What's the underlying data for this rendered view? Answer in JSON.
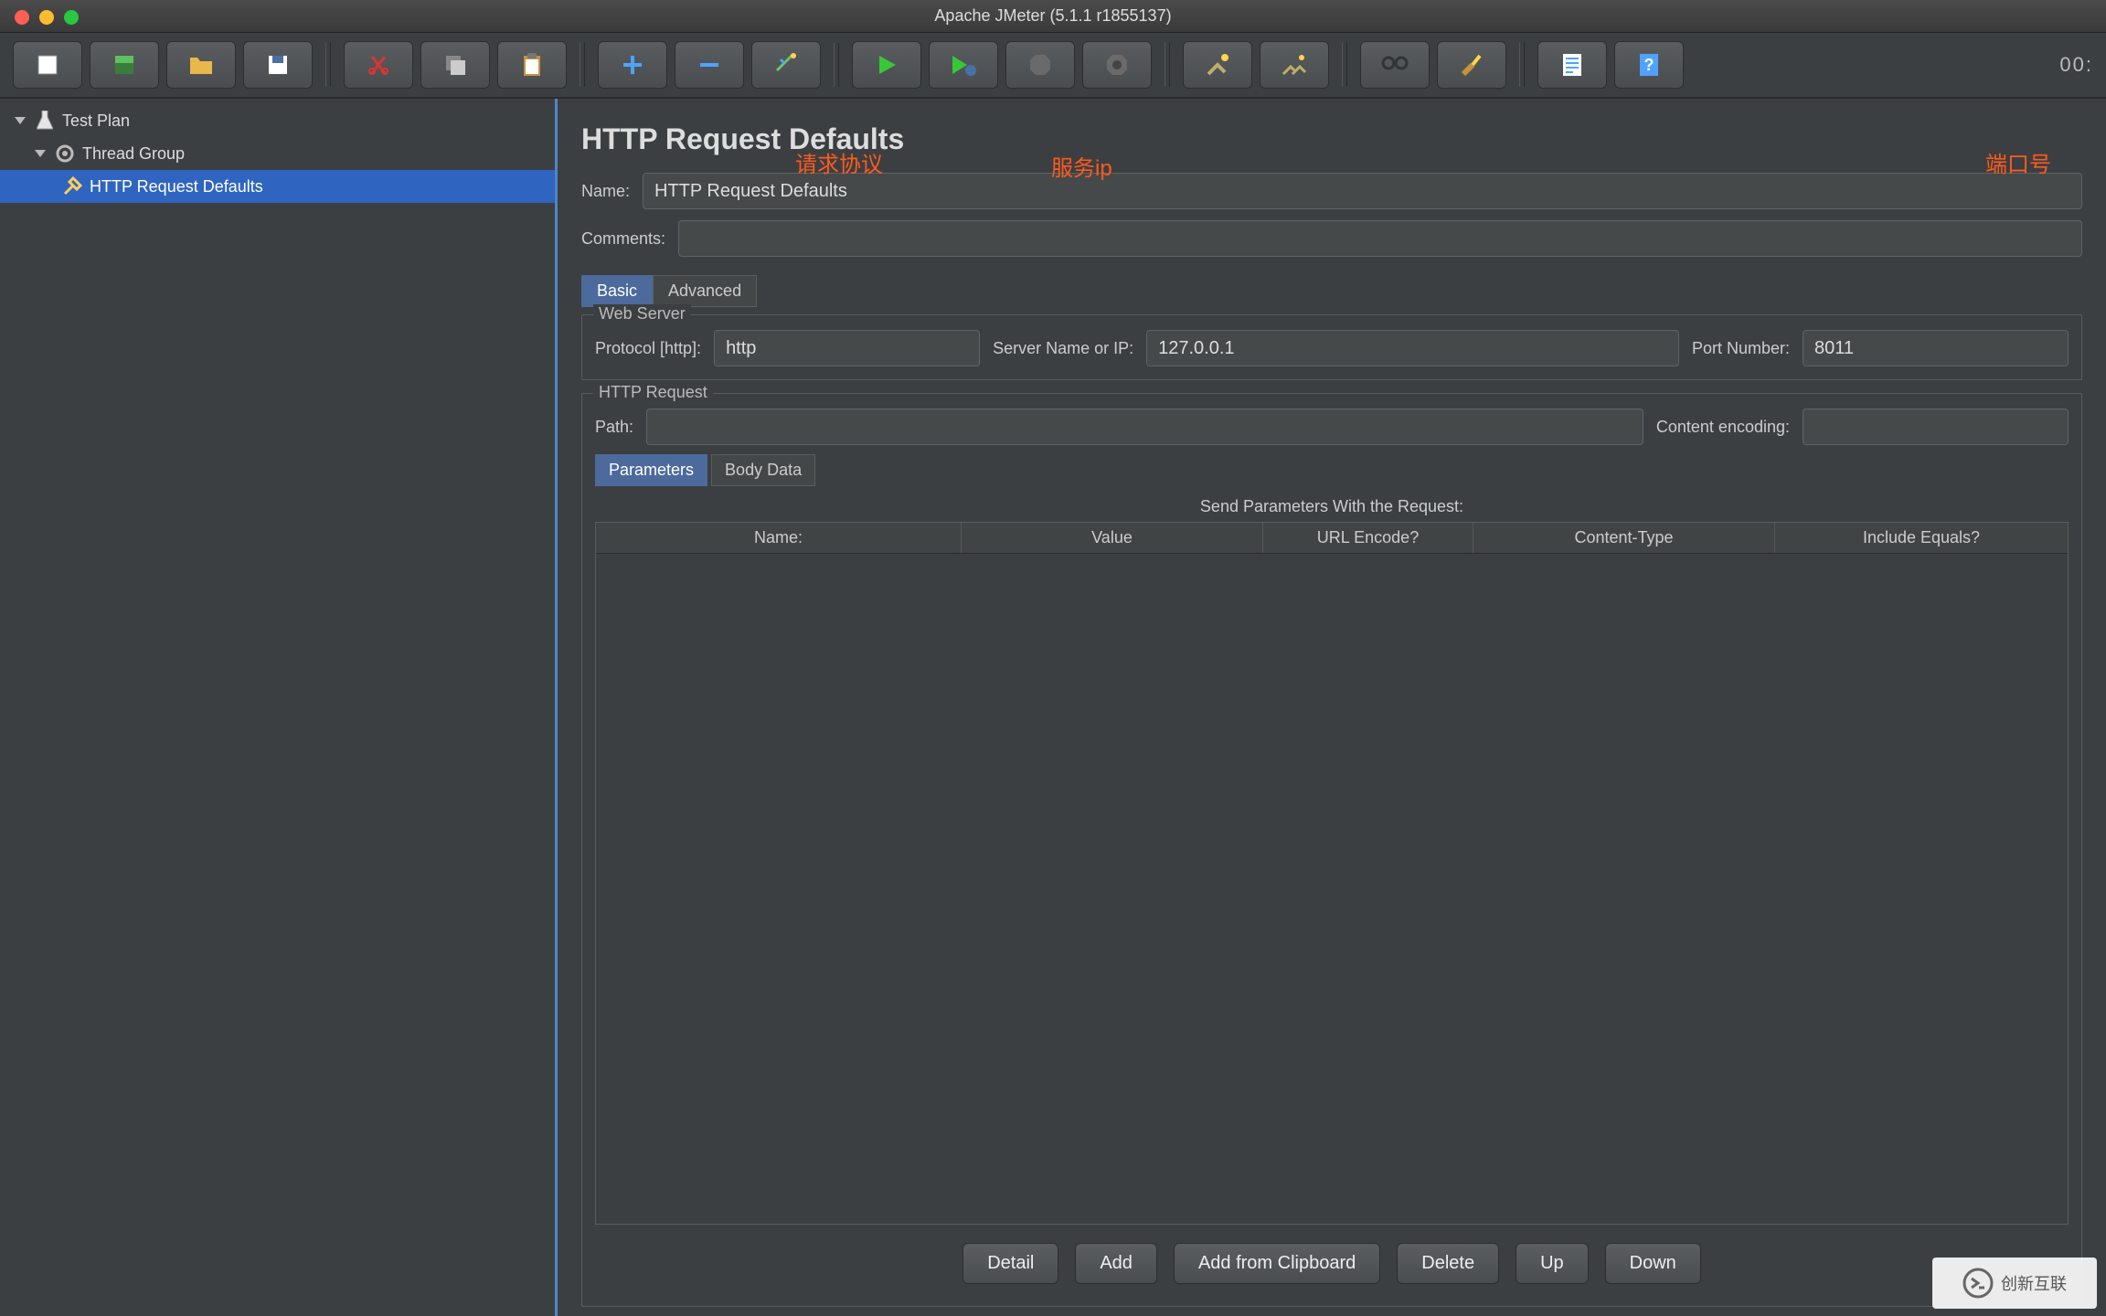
{
  "window": {
    "title": "Apache JMeter (5.1.1 r1855137)"
  },
  "toolbar": {
    "buttons": [
      "new",
      "templates",
      "open",
      "save",
      "cut",
      "copy",
      "paste",
      "add",
      "remove",
      "toggle",
      "start",
      "start-no-timers",
      "stop",
      "shutdown",
      "clear",
      "clear-all",
      "search",
      "reset-search",
      "function-helper",
      "help"
    ],
    "timer": "00:"
  },
  "tree": {
    "nodes": [
      {
        "label": "Test Plan",
        "icon": "flask"
      },
      {
        "label": "Thread Group",
        "icon": "gear"
      },
      {
        "label": "HTTP Request Defaults",
        "icon": "wrench",
        "selected": true
      }
    ]
  },
  "panel": {
    "heading": "HTTP Request Defaults",
    "name_label": "Name:",
    "name_value": "HTTP Request Defaults",
    "comments_label": "Comments:",
    "comments_value": "",
    "tabs": {
      "basic": "Basic",
      "advanced": "Advanced"
    },
    "web_server": {
      "legend": "Web Server",
      "protocol_label": "Protocol [http]:",
      "protocol_value": "http",
      "server_label": "Server Name or IP:",
      "server_value": "127.0.0.1",
      "port_label": "Port Number:",
      "port_value": "8011"
    },
    "http_request": {
      "legend": "HTTP Request",
      "path_label": "Path:",
      "path_value": "",
      "encoding_label": "Content encoding:",
      "encoding_value": ""
    },
    "param_tabs": {
      "parameters": "Parameters",
      "body": "Body Data"
    },
    "param_header": "Send Parameters With the Request:",
    "columns": [
      "Name:",
      "Value",
      "URL Encode?",
      "Content-Type",
      "Include Equals?"
    ],
    "buttons": {
      "detail": "Detail",
      "add": "Add",
      "clipboard": "Add from Clipboard",
      "delete": "Delete",
      "up": "Up",
      "down": "Down"
    }
  },
  "annotations": {
    "protocol": "请求协议",
    "server": "服务ip",
    "port": "端口号"
  },
  "watermark": "创新互联"
}
